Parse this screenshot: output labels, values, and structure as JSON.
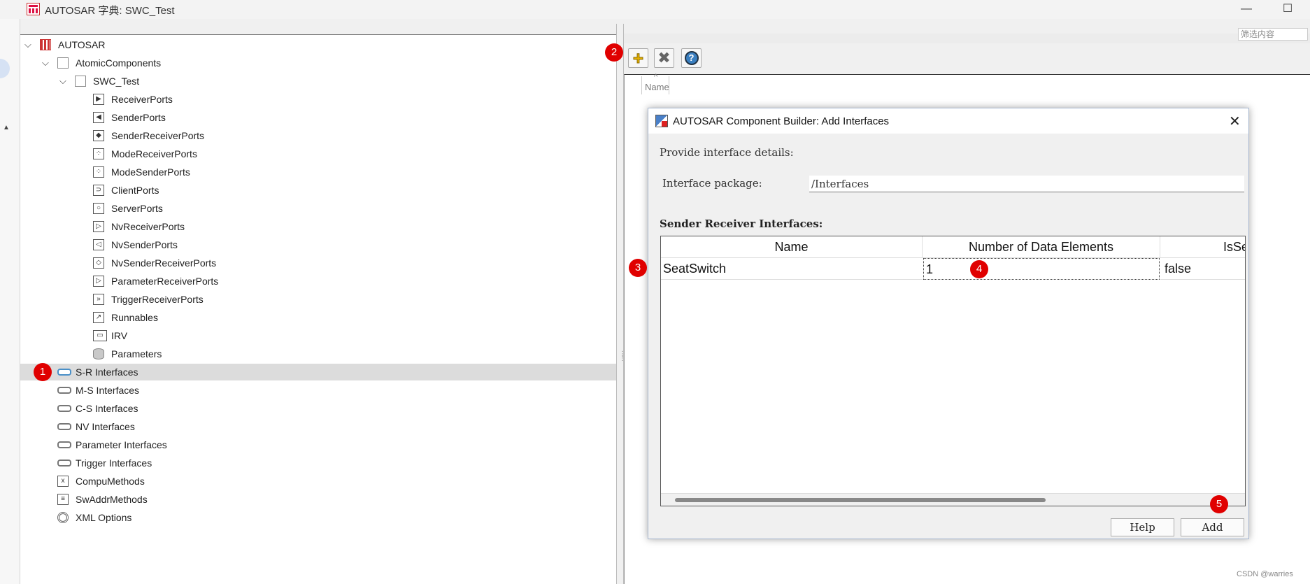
{
  "window": {
    "title": "AUTOSAR 字典: SWC_Test",
    "minimize_icon": "—",
    "maximize_icon": "☐"
  },
  "tree": {
    "root": "AUTOSAR",
    "atomic_components": "AtomicComponents",
    "component": "SWC_Test",
    "component_children": [
      "ReceiverPorts",
      "SenderPorts",
      "SenderReceiverPorts",
      "ModeReceiverPorts",
      "ModeSenderPorts",
      "ClientPorts",
      "ServerPorts",
      "NvReceiverPorts",
      "NvSenderPorts",
      "NvSenderReceiverPorts",
      "ParameterReceiverPorts",
      "TriggerReceiverPorts",
      "Runnables",
      "IRV",
      "Parameters"
    ],
    "top_level": [
      "S-R Interfaces",
      "M-S Interfaces",
      "C-S Interfaces",
      "NV Interfaces",
      "Parameter Interfaces",
      "Trigger Interfaces",
      "CompuMethods",
      "SwAddrMethods",
      "XML Options"
    ],
    "selected": "S-R Interfaces"
  },
  "right_panel": {
    "filter_placeholder": "筛选内容",
    "name_column": "Name"
  },
  "dialog": {
    "title": "AUTOSAR Component Builder: Add Interfaces",
    "instruction": "Provide interface details:",
    "package_label": "Interface package:",
    "package_value": "/Interfaces",
    "table_heading": "Sender Receiver Interfaces:",
    "columns": [
      "Name",
      "Number of Data Elements",
      "IsSe"
    ],
    "rows": [
      [
        "SeatSwitch",
        "1",
        "false"
      ]
    ],
    "help_button": "Help",
    "add_button": "Add"
  },
  "annotations": [
    "1",
    "2",
    "3",
    "4",
    "5"
  ],
  "watermark": "CSDN @warries",
  "colors": {
    "badge": "#e00000",
    "selection": "#dcdcdc"
  }
}
